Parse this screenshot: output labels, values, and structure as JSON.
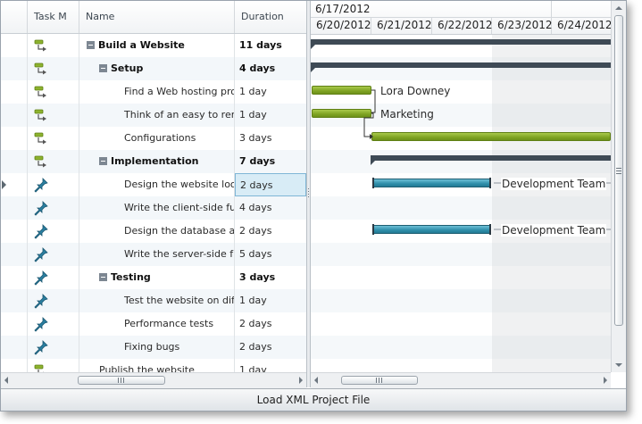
{
  "grid": {
    "columns": {
      "mode": "Task M",
      "name": "Name",
      "duration": "Duration"
    },
    "rows": [
      {
        "mode": "auto",
        "name": "Build a Website",
        "duration": "11 days",
        "level": 0,
        "summary": true
      },
      {
        "mode": "auto",
        "name": "Setup",
        "duration": "4 days",
        "level": 1,
        "summary": true
      },
      {
        "mode": "auto",
        "name": "Find a Web hosting prov",
        "duration": "1 day",
        "level": 2,
        "summary": false
      },
      {
        "mode": "auto",
        "name": "Think of an easy to reme",
        "duration": "1 day",
        "level": 2,
        "summary": false
      },
      {
        "mode": "auto",
        "name": "Configurations",
        "duration": "3 days",
        "level": 2,
        "summary": false
      },
      {
        "mode": "auto",
        "name": "Implementation",
        "duration": "7 days",
        "level": 1,
        "summary": true
      },
      {
        "mode": "manual",
        "name": "Design the website look",
        "duration": "2 days",
        "level": 2,
        "summary": false,
        "selected": true
      },
      {
        "mode": "manual",
        "name": "Write the client-side func",
        "duration": "4 days",
        "level": 2,
        "summary": false
      },
      {
        "mode": "manual",
        "name": "Design the database and",
        "duration": "2 days",
        "level": 2,
        "summary": false
      },
      {
        "mode": "manual",
        "name": "Write the server-side fun",
        "duration": "5 days",
        "level": 2,
        "summary": false
      },
      {
        "mode": "manual",
        "name": "Testing",
        "duration": "3 days",
        "level": 1,
        "summary": true
      },
      {
        "mode": "manual",
        "name": "Test the website on diffe",
        "duration": "1 day",
        "level": 2,
        "summary": false
      },
      {
        "mode": "manual",
        "name": "Performance tests",
        "duration": "2 days",
        "level": 2,
        "summary": false
      },
      {
        "mode": "manual",
        "name": "Fixing bugs",
        "duration": "2 days",
        "level": 2,
        "summary": false
      },
      {
        "mode": "auto",
        "name": "Publish the website",
        "duration": "1 day",
        "level": 1,
        "summary": false
      }
    ]
  },
  "gantt": {
    "week_label": "6/17/2012",
    "days": [
      "6/20/2012",
      "6/21/2012",
      "6/22/2012",
      "6/23/2012",
      "6/24/2012"
    ],
    "resources": {
      "row2": "Lora Downey",
      "row3": "Marketing",
      "row6": "Development Team",
      "row8": "Development Team"
    }
  },
  "footer": {
    "load_button_label": "Load XML Project File"
  },
  "colors": {
    "task_bar": "#7fa323",
    "manual_bar": "#2e8eaa",
    "summary_bar": "#3e4a55",
    "selection": "#d8ecf6"
  },
  "icons": {
    "auto_mode": "auto-scheduled-task-icon",
    "manual_mode": "manually-scheduled-pin-icon"
  }
}
